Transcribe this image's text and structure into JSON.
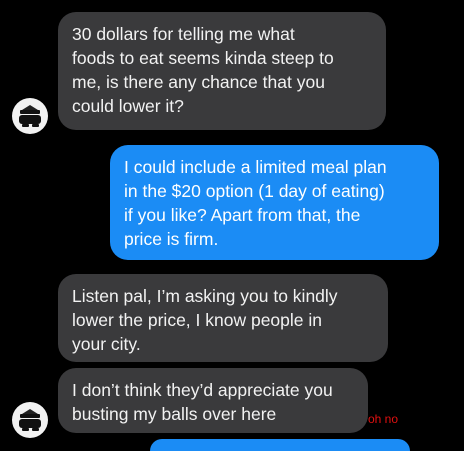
{
  "thread": {
    "messages": [
      {
        "sender": "them",
        "text": "30 dollars for telling me what\nfoods to eat seems kinda steep to\nme, is there any chance that you\ncould lower it?"
      },
      {
        "sender": "me",
        "text": "I could include a limited meal plan\nin the $20 option (1 day of eating)\nif you like? Apart from that, the\nprice is firm."
      },
      {
        "sender": "them",
        "text": "Listen pal, I’m asking you to kindly\nlower the price, I know people in\nyour city."
      },
      {
        "sender": "them",
        "text": "I don’t think they’d appreciate you\nbusting my balls over here"
      }
    ],
    "annotation": "oh no"
  },
  "colors": {
    "background": "#000000",
    "incoming_bubble": "#3a3a3c",
    "outgoing_bubble": "#1b8cf5",
    "annotation_red": "#e01010"
  },
  "icons": {
    "avatar": "contact-avatar-icon"
  }
}
